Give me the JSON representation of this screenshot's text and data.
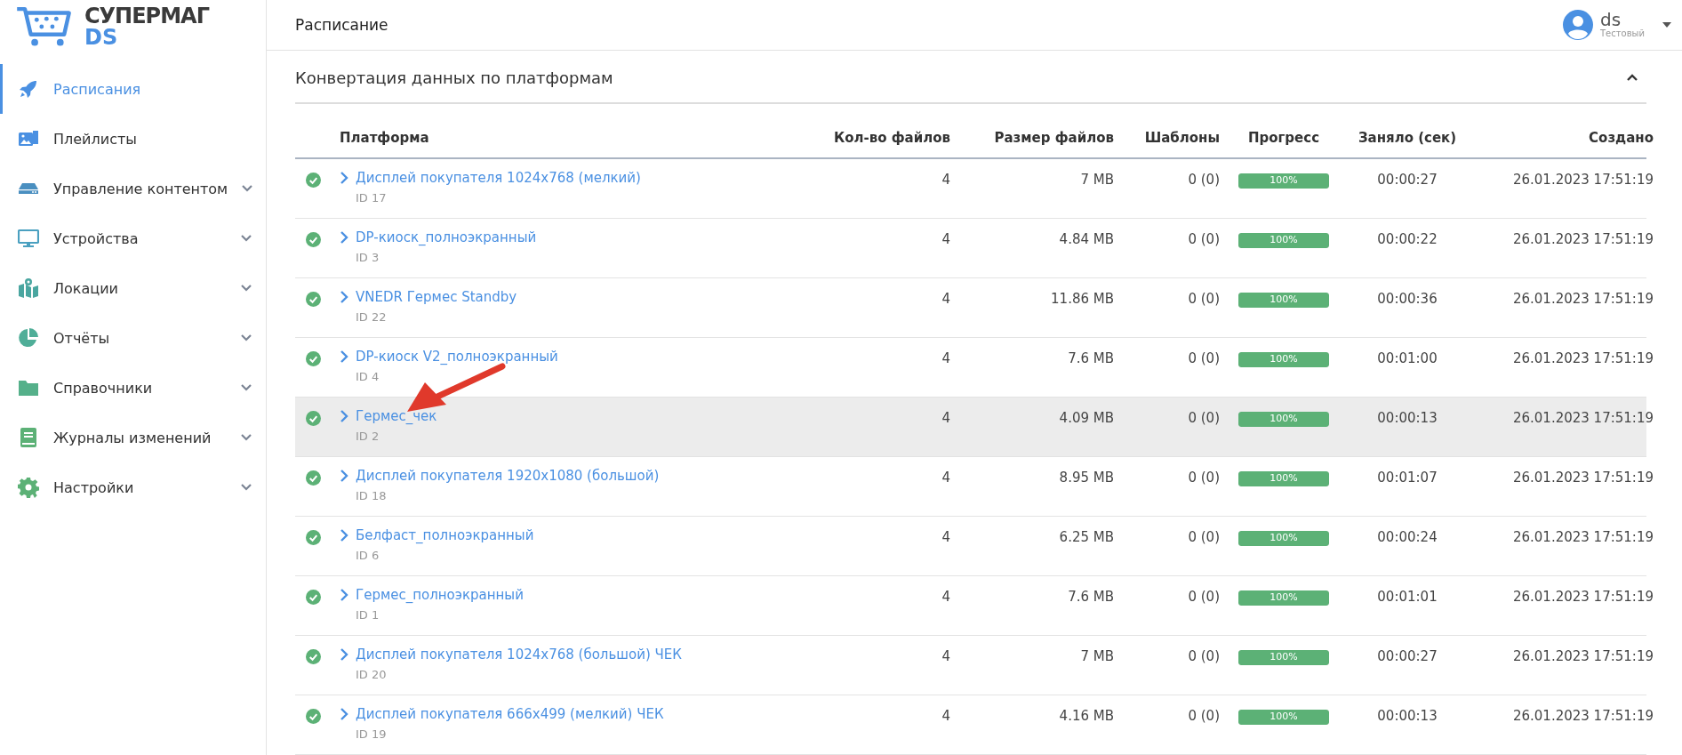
{
  "logo": {
    "name": "СУПЕРМАГ",
    "suffix": "DS"
  },
  "sidebar": {
    "items": [
      {
        "label": "Расписания",
        "selected": true,
        "expandable": false
      },
      {
        "label": "Плейлисты",
        "selected": false,
        "expandable": false
      },
      {
        "label": "Управление контентом",
        "selected": false,
        "expandable": true
      },
      {
        "label": "Устройства",
        "selected": false,
        "expandable": true
      },
      {
        "label": "Локации",
        "selected": false,
        "expandable": true
      },
      {
        "label": "Отчёты",
        "selected": false,
        "expandable": true
      },
      {
        "label": "Справочники",
        "selected": false,
        "expandable": true
      },
      {
        "label": "Журналы изменений",
        "selected": false,
        "expandable": true
      },
      {
        "label": "Настройки",
        "selected": false,
        "expandable": true
      }
    ]
  },
  "header": {
    "title": "Расписание",
    "user": {
      "name": "ds",
      "role": "Тестовый"
    }
  },
  "section": {
    "title": "Конвертация данных по платформам",
    "expanded": true,
    "table": {
      "columns": [
        "Платформа",
        "Кол-во файлов",
        "Размер файлов",
        "Шаблоны",
        "Прогресс",
        "Заняло (сек)",
        "Создано"
      ],
      "rows": [
        {
          "name": "Дисплей покупателя 1024x768 (мелкий)",
          "id": "ID 17",
          "files": "4",
          "size": "7 MB",
          "templates": "0 (0)",
          "level": 1,
          "progress": "100%",
          "elapsed": "00:00:27",
          "created": "26.01.2023 17:51:19",
          "selected": false
        },
        {
          "name": "DP-киоск_полноэкранный",
          "id": "ID 3",
          "files": "4",
          "size": "4.84 MB",
          "templates": "0 (0)",
          "level": 1,
          "progress": "100%",
          "elapsed": "00:00:22",
          "created": "26.01.2023 17:51:19",
          "selected": false
        },
        {
          "name": "VNEDR Гермес Standby",
          "id": "ID 22",
          "files": "4",
          "size": "11.86 MB",
          "templates": "0 (0)",
          "level": 1,
          "progress": "100%",
          "elapsed": "00:00:36",
          "created": "26.01.2023 17:51:19",
          "selected": false
        },
        {
          "name": "DP-киоск V2_полноэкранный",
          "id": "ID 4",
          "files": "4",
          "size": "7.6 MB",
          "templates": "0 (0)",
          "level": 1,
          "progress": "100%",
          "elapsed": "00:01:00",
          "created": "26.01.2023 17:51:19",
          "selected": false
        },
        {
          "name": "Гермес_чек",
          "id": "ID 2",
          "files": "4",
          "size": "4.09 MB",
          "templates": "0 (0)",
          "level": 1,
          "progress": "100%",
          "elapsed": "00:00:13",
          "created": "26.01.2023 17:51:19",
          "selected": true
        },
        {
          "name": "Дисплей покупателя 1920x1080 (большой)",
          "id": "ID 18",
          "files": "4",
          "size": "8.95 MB",
          "templates": "0 (0)",
          "level": 1,
          "progress": "100%",
          "elapsed": "00:01:07",
          "created": "26.01.2023 17:51:19",
          "selected": false
        },
        {
          "name": "Белфаст_полноэкранный",
          "id": "ID 6",
          "files": "4",
          "size": "6.25 MB",
          "templates": "0 (0)",
          "level": 1,
          "progress": "100%",
          "elapsed": "00:00:24",
          "created": "26.01.2023 17:51:19",
          "selected": false
        },
        {
          "name": "Гермес_полноэкранный",
          "id": "ID 1",
          "files": "4",
          "size": "7.6 MB",
          "templates": "0 (0)",
          "level": 1,
          "progress": "100%",
          "elapsed": "00:01:01",
          "created": "26.01.2023 17:51:19",
          "selected": false
        },
        {
          "name": "Дисплей покупателя 1024x768 (большой) ЧЕК",
          "id": "ID 20",
          "files": "4",
          "size": "7 MB",
          "templates": "0 (0)",
          "level": 1,
          "progress": "100%",
          "elapsed": "00:00:27",
          "created": "26.01.2023 17:51:19",
          "selected": false
        },
        {
          "name": "Дисплей покупателя 666x499 (мелкий) ЧЕК",
          "id": "ID 19",
          "files": "4",
          "size": "4.16 MB",
          "templates": "0 (0)",
          "level": 1,
          "progress": "100%",
          "elapsed": "00:00:13",
          "created": "26.01.2023 17:51:19",
          "selected": false
        }
      ]
    }
  }
}
